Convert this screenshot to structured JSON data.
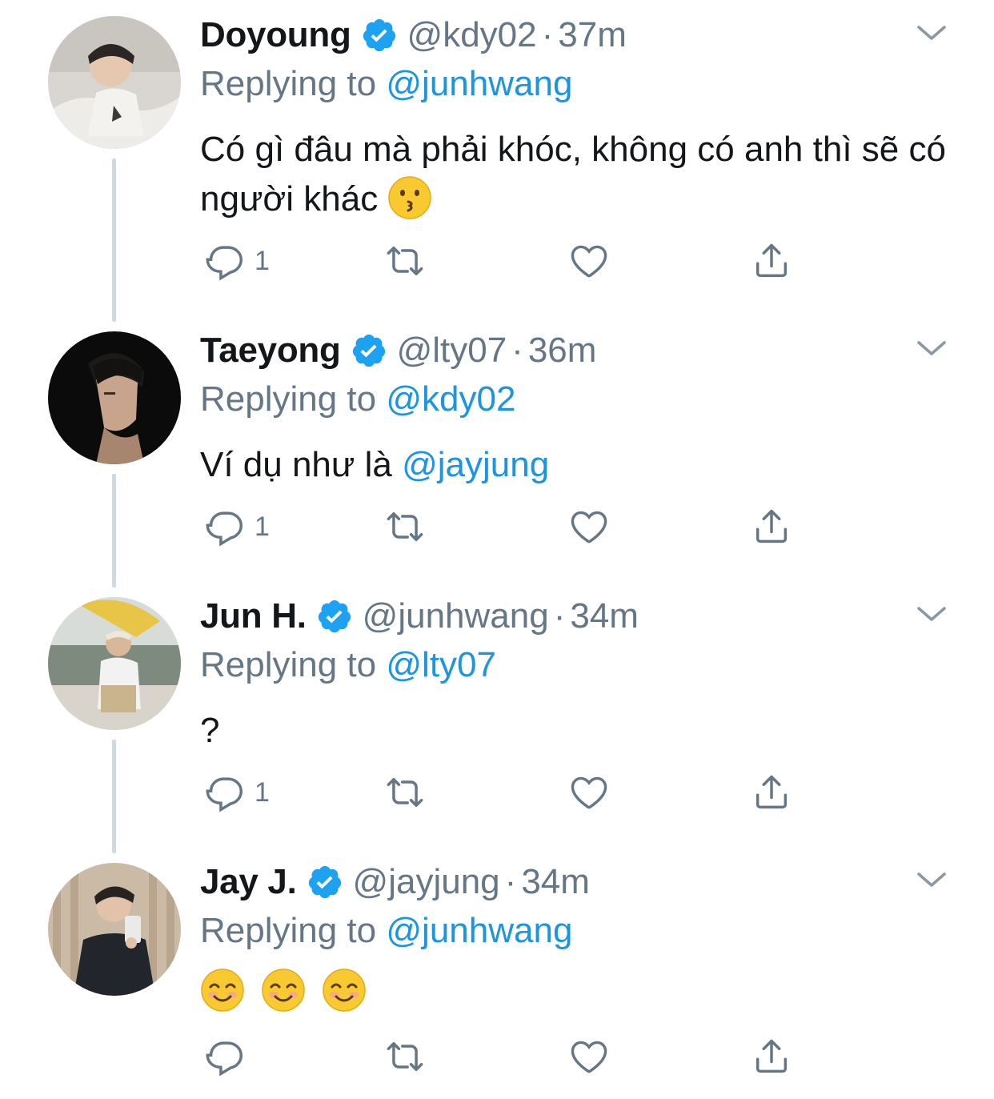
{
  "tweets": [
    {
      "display_name": "Doyoung",
      "handle": "@kdy02",
      "time": "37m",
      "replying_prefix": "Replying to",
      "replying_to": "@junhwang",
      "text": "Có gì đâu mà phải khóc, không có anh thì sẽ có người khác",
      "emoji": [
        "kissing-face"
      ],
      "reply_count": "1"
    },
    {
      "display_name": "Taeyong",
      "handle": "@lty07",
      "time": "36m",
      "replying_prefix": "Replying to",
      "replying_to": "@kdy02",
      "text": "Ví dụ như là",
      "text_mention": "@jayjung",
      "reply_count": "1"
    },
    {
      "display_name": "Jun H.",
      "handle": "@junhwang",
      "time": "34m",
      "replying_prefix": "Replying to",
      "replying_to": "@lty07",
      "text": "?",
      "reply_count": "1"
    },
    {
      "display_name": "Jay J.",
      "handle": "@jayjung",
      "time": "34m",
      "replying_prefix": "Replying to",
      "replying_to": "@junhwang",
      "text": "",
      "emoji": [
        "smiling-face",
        "smiling-face",
        "smiling-face"
      ],
      "reply_count": ""
    }
  ],
  "separator": "·",
  "colors": {
    "text": "#14171a",
    "secondary": "#657786",
    "link": "#1b95e0",
    "verified": "#1da1f2",
    "thread_line": "#cfd9de"
  },
  "icons": {
    "reply": "reply-icon",
    "retweet": "retweet-icon",
    "like": "heart-icon",
    "share": "share-icon",
    "verified": "verified-badge-icon",
    "more": "chevron-down-icon"
  }
}
